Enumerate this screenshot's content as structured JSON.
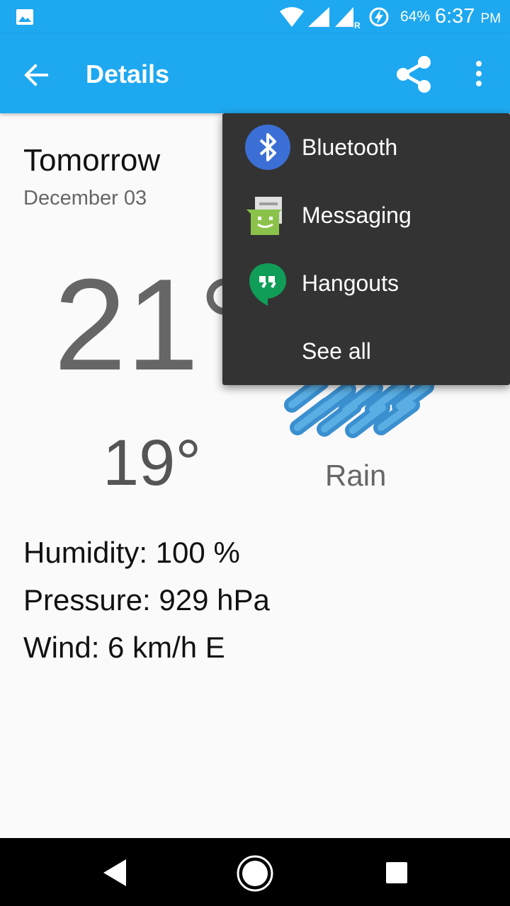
{
  "status_bar": {
    "battery": "64%",
    "time": "6:37",
    "ampm": "PM",
    "icons": [
      "image-icon",
      "wifi-icon",
      "signal-icon",
      "signal-roaming-icon",
      "battery-charging-icon"
    ]
  },
  "app_bar": {
    "title": "Details",
    "icons": [
      "back-arrow-icon",
      "share-icon",
      "more-vert-icon"
    ]
  },
  "forecast": {
    "day": "Tomorrow",
    "date": "December 03",
    "high": "21°",
    "low": "19°",
    "condition": "Rain",
    "humidity": "Humidity: 100 %",
    "pressure": "Pressure: 929 hPa",
    "wind": "Wind: 6 km/h E"
  },
  "share_menu": {
    "items": [
      {
        "label": "Bluetooth",
        "icon": "bluetooth-icon"
      },
      {
        "label": "Messaging",
        "icon": "messaging-icon"
      },
      {
        "label": "Hangouts",
        "icon": "hangouts-icon"
      },
      {
        "label": "See all",
        "icon": ""
      }
    ]
  },
  "nav_bar": {
    "icons": [
      "back-triangle-icon",
      "home-circle-icon",
      "recents-square-icon"
    ]
  },
  "colors": {
    "primary": "#1ea8f0",
    "popup": "#333333",
    "background": "#fafafa",
    "rain": "#3a8fcf"
  }
}
